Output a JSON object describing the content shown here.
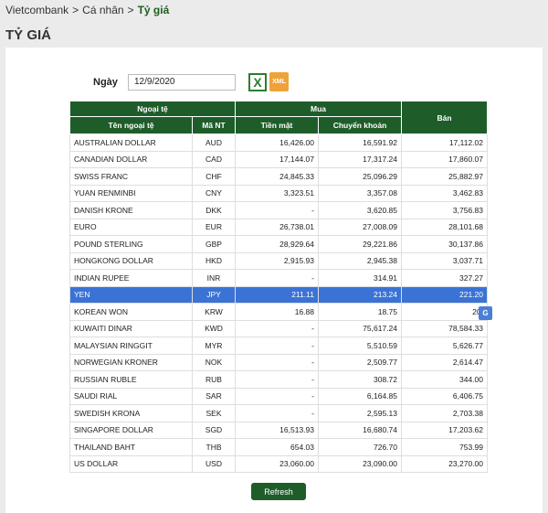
{
  "breadcrumb": {
    "items": [
      "Vietcombank",
      "Cá nhân",
      "Tỷ giá"
    ],
    "separator": ">"
  },
  "page_title": "TỶ GIÁ",
  "date_filter": {
    "label": "Ngày",
    "value": "12/9/2020"
  },
  "export": {
    "excel_icon": "excel-icon",
    "excel_glyph": "X",
    "xml_label": "XML"
  },
  "table": {
    "group_headers": {
      "currency": "Ngoại tệ",
      "buy": "Mua",
      "sell": "Bán"
    },
    "columns": {
      "name": "Tên ngoại tệ",
      "code": "Mã NT",
      "cash": "Tiền mặt",
      "transfer": "Chuyển khoản"
    },
    "rows": [
      {
        "name": "AUSTRALIAN DOLLAR",
        "code": "AUD",
        "cash": "16,426.00",
        "transfer": "16,591.92",
        "sell": "17,112.02"
      },
      {
        "name": "CANADIAN DOLLAR",
        "code": "CAD",
        "cash": "17,144.07",
        "transfer": "17,317.24",
        "sell": "17,860.07"
      },
      {
        "name": "SWISS FRANC",
        "code": "CHF",
        "cash": "24,845.33",
        "transfer": "25,096.29",
        "sell": "25,882.97"
      },
      {
        "name": "YUAN RENMINBI",
        "code": "CNY",
        "cash": "3,323.51",
        "transfer": "3,357.08",
        "sell": "3,462.83"
      },
      {
        "name": "DANISH KRONE",
        "code": "DKK",
        "cash": "-",
        "transfer": "3,620.85",
        "sell": "3,756.83"
      },
      {
        "name": "EURO",
        "code": "EUR",
        "cash": "26,738.01",
        "transfer": "27,008.09",
        "sell": "28,101.68"
      },
      {
        "name": "POUND STERLING",
        "code": "GBP",
        "cash": "28,929.64",
        "transfer": "29,221.86",
        "sell": "30,137.86"
      },
      {
        "name": "HONGKONG DOLLAR",
        "code": "HKD",
        "cash": "2,915.93",
        "transfer": "2,945.38",
        "sell": "3,037.71"
      },
      {
        "name": "INDIAN RUPEE",
        "code": "INR",
        "cash": "-",
        "transfer": "314.91",
        "sell": "327.27"
      },
      {
        "name": "YEN",
        "code": "JPY",
        "cash": "211.11",
        "transfer": "213.24",
        "sell": "221.20"
      },
      {
        "name": "KOREAN WON",
        "code": "KRW",
        "cash": "16.88",
        "transfer": "18.75",
        "sell": "20."
      },
      {
        "name": "KUWAITI DINAR",
        "code": "KWD",
        "cash": "-",
        "transfer": "75,617.24",
        "sell": "78,584.33"
      },
      {
        "name": "MALAYSIAN RINGGIT",
        "code": "MYR",
        "cash": "-",
        "transfer": "5,510.59",
        "sell": "5,626.77"
      },
      {
        "name": "NORWEGIAN KRONER",
        "code": "NOK",
        "cash": "-",
        "transfer": "2,509.77",
        "sell": "2,614.47"
      },
      {
        "name": "RUSSIAN RUBLE",
        "code": "RUB",
        "cash": "-",
        "transfer": "308.72",
        "sell": "344.00"
      },
      {
        "name": "SAUDI RIAL",
        "code": "SAR",
        "cash": "-",
        "transfer": "6,164.85",
        "sell": "6,406.75"
      },
      {
        "name": "SWEDISH KRONA",
        "code": "SEK",
        "cash": "-",
        "transfer": "2,595.13",
        "sell": "2,703.38"
      },
      {
        "name": "SINGAPORE DOLLAR",
        "code": "SGD",
        "cash": "16,513.93",
        "transfer": "16,680.74",
        "sell": "17,203.62"
      },
      {
        "name": "THAILAND BAHT",
        "code": "THB",
        "cash": "654.03",
        "transfer": "726.70",
        "sell": "753.99"
      },
      {
        "name": "US DOLLAR",
        "code": "USD",
        "cash": "23,060.00",
        "transfer": "23,090.00",
        "sell": "23,270.00"
      }
    ],
    "selected_row": "JPY"
  },
  "translate_popup": {
    "icon": "translate-icon",
    "glyph": "G"
  },
  "refresh_label": "Refresh",
  "colors": {
    "brand_green": "#1e5d2a",
    "selection_blue": "#3b73d5",
    "xml_orange": "#f0a23a"
  }
}
